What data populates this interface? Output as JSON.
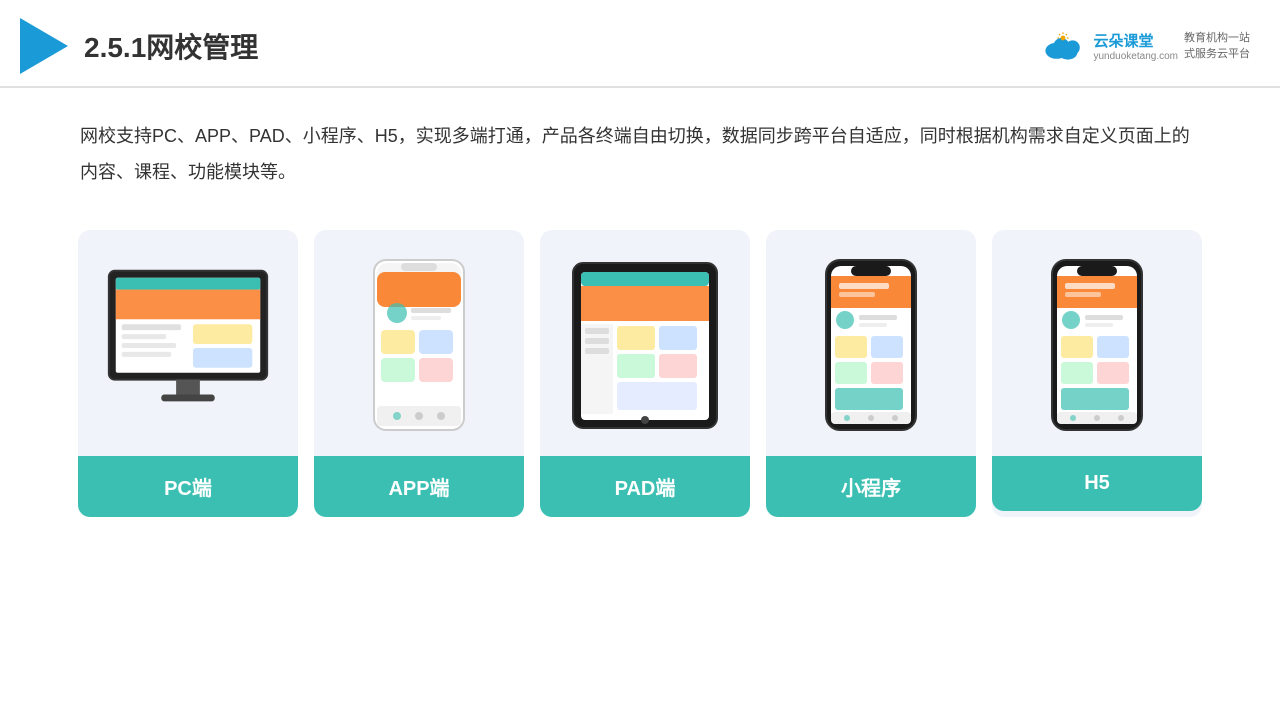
{
  "header": {
    "title": "2.5.1网校管理",
    "brand": {
      "name": "云朵课堂",
      "tagline": "教育机构一站\n式服务云平台",
      "url": "yunduoketang.com"
    }
  },
  "description": "网校支持PC、APP、PAD、小程序、H5，实现多端打通，产品各终端自由切换，数据同步跨平台自适应，同时根据机构需求自定义页面上的内容、课程、功能模块等。",
  "cards": [
    {
      "id": "pc",
      "label": "PC端"
    },
    {
      "id": "app",
      "label": "APP端"
    },
    {
      "id": "pad",
      "label": "PAD端"
    },
    {
      "id": "miniprogram",
      "label": "小程序"
    },
    {
      "id": "h5",
      "label": "H5"
    }
  ],
  "colors": {
    "accent": "#1a9ad7",
    "card_bg": "#edf2fa",
    "label_bg": "#3bbfb2",
    "title_color": "#333"
  }
}
